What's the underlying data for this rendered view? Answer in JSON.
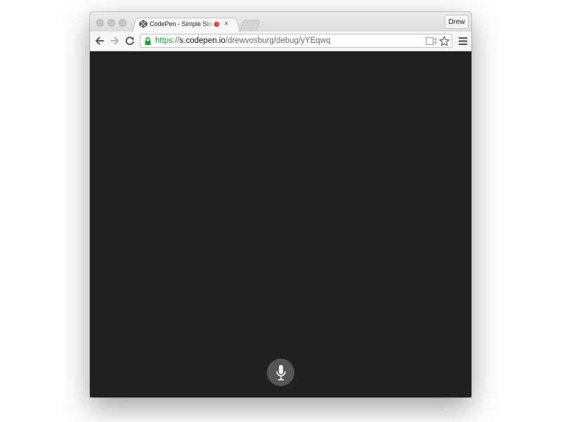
{
  "browser": {
    "tab": {
      "title": "CodePen - Simple Siri Debug",
      "favicon": "codepen-logo-icon",
      "recording": true,
      "close_glyph": "×"
    },
    "profile_label": "Drew",
    "address": {
      "scheme": "https://",
      "host": "s.codepen.io",
      "path": "/drewvosburg/debug/yYEqwq"
    },
    "toolbar_icons": [
      "back-arrow-icon",
      "forward-arrow-icon",
      "reload-icon",
      "lock-icon",
      "camera-icon",
      "star-icon",
      "menu-icon"
    ]
  },
  "page": {
    "background": "#212121",
    "mic_button": {
      "icon": "microphone-icon",
      "color": "#555555"
    }
  },
  "colors": {
    "secure_scheme": "#1f9e3a",
    "recording_dot": "#e74c3c"
  }
}
